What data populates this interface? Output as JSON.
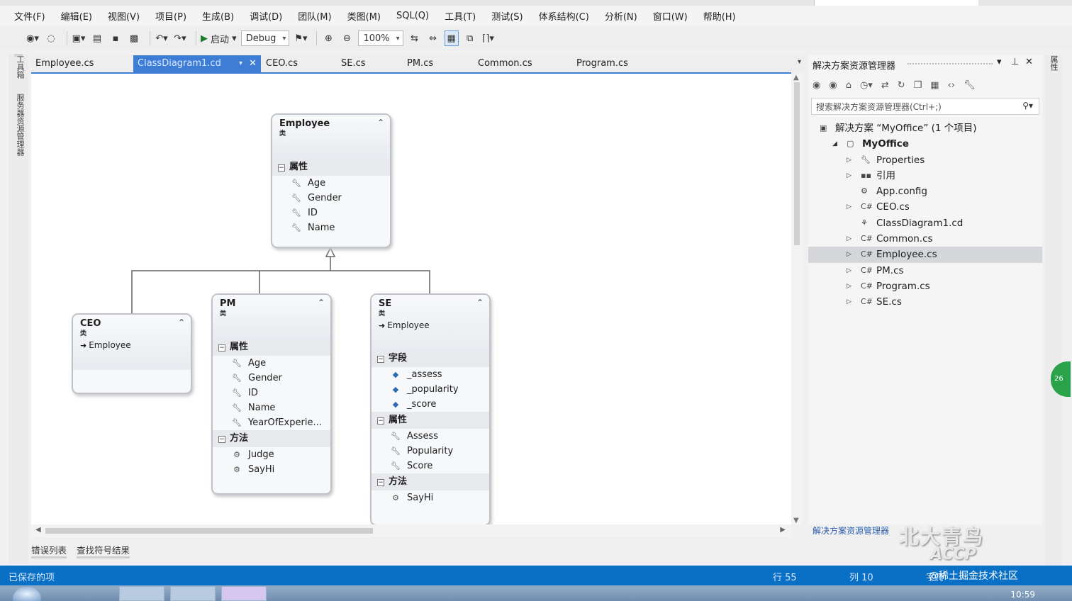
{
  "menu": [
    "文件(F)",
    "编辑(E)",
    "视图(V)",
    "项目(P)",
    "生成(B)",
    "调试(D)",
    "团队(M)",
    "类图(M)",
    "SQL(Q)",
    "工具(T)",
    "测试(S)",
    "体系结构(C)",
    "分析(N)",
    "窗口(W)",
    "帮助(H)"
  ],
  "toolbar": {
    "start_label": "启动",
    "config": "Debug",
    "zoom": "100%"
  },
  "left_rail": {
    "toolbox": "工具箱",
    "server_explorer": "服务器资源管理器"
  },
  "right_rail": {
    "label": "属性",
    "bubble": "26"
  },
  "doc_tabs": [
    "Employee.cs",
    "ClassDiagram1.cd",
    "CEO.cs",
    "SE.cs",
    "PM.cs",
    "Common.cs",
    "Program.cs"
  ],
  "active_tab": "ClassDiagram1.cd",
  "diagram": {
    "employee": {
      "name": "Employee",
      "kind": "类",
      "props_title": "属性",
      "props": [
        "Age",
        "Gender",
        "ID",
        "Name"
      ]
    },
    "ceo": {
      "name": "CEO",
      "kind": "类",
      "base": "Employee"
    },
    "pm": {
      "name": "PM",
      "kind": "类",
      "props_title": "属性",
      "props": [
        "Age",
        "Gender",
        "ID",
        "Name",
        "YearOfExperie..."
      ],
      "methods_title": "方法",
      "methods": [
        "Judge",
        "SayHi"
      ]
    },
    "se": {
      "name": "SE",
      "kind": "类",
      "base": "Employee",
      "fields_title": "字段",
      "fields": [
        "_assess",
        "_popularity",
        "_score"
      ],
      "props_title": "属性",
      "props": [
        "Assess",
        "Popularity",
        "Score"
      ],
      "methods_title": "方法",
      "methods": [
        "SayHi"
      ]
    }
  },
  "solution_explorer": {
    "title": "解决方案资源管理器",
    "search_placeholder": "搜索解决方案资源管理器(Ctrl+;)",
    "bottom_link": "解决方案资源管理器",
    "tree": [
      {
        "label": "解决方案 “MyOffice” (1 个项目)",
        "level": 0,
        "icon": "solution-icon",
        "expander": "none"
      },
      {
        "label": "MyOffice",
        "level": 1,
        "icon": "project-icon",
        "expander": "expanded",
        "bold": true
      },
      {
        "label": "Properties",
        "level": 2,
        "icon": "wrench-icon",
        "expander": "collapsed"
      },
      {
        "label": "引用",
        "level": 2,
        "icon": "references-icon",
        "expander": "collapsed"
      },
      {
        "label": "App.config",
        "level": 2,
        "icon": "config-icon",
        "expander": "none"
      },
      {
        "label": "CEO.cs",
        "level": 2,
        "icon": "csharp-icon",
        "expander": "collapsed"
      },
      {
        "label": "ClassDiagram1.cd",
        "level": 2,
        "icon": "diagram-icon",
        "expander": "none"
      },
      {
        "label": "Common.cs",
        "level": 2,
        "icon": "csharp-icon",
        "expander": "collapsed"
      },
      {
        "label": "Employee.cs",
        "level": 2,
        "icon": "csharp-icon",
        "expander": "collapsed",
        "selected": true
      },
      {
        "label": "PM.cs",
        "level": 2,
        "icon": "csharp-icon",
        "expander": "collapsed"
      },
      {
        "label": "Program.cs",
        "level": 2,
        "icon": "csharp-icon",
        "expander": "collapsed"
      },
      {
        "label": "SE.cs",
        "level": 2,
        "icon": "csharp-icon",
        "expander": "collapsed"
      }
    ]
  },
  "bottom_tabs": [
    "错误列表",
    "查找符号结果"
  ],
  "status": {
    "left": "已保存的项",
    "line": "行 55",
    "col": "列 10",
    "char": "字符"
  },
  "watermark": {
    "logo_big": "北大青鸟",
    "logo_sub": "ACCP",
    "text": "@稀土掘金技术社区"
  },
  "taskbar": {
    "clock": "10:59"
  },
  "colors": {
    "accent": "#3d7dd6",
    "status_bar": "#0a70c6",
    "selection": "#d4d6da"
  }
}
